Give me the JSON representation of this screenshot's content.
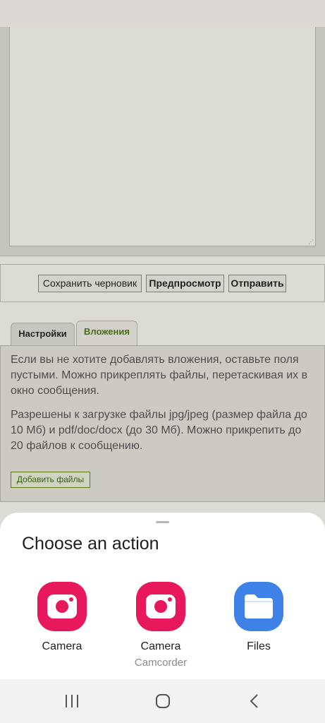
{
  "page": {
    "buttons": {
      "save_draft": "Сохранить черновик",
      "preview": "Предпросмотр",
      "send": "Отправить"
    },
    "tabs": [
      {
        "label": "Настройки",
        "active": false
      },
      {
        "label": "Вложения",
        "active": true
      }
    ],
    "attachments": {
      "paragraph1": "Если вы не хотите добавлять вложения, оставьте поля пустыми. Можно прикреплять файлы, перетаскивая их в окно сообщения.",
      "paragraph2": "Разрешены к загрузке файлы jpg/jpeg (размер файла до 10 Мб) и pdf/doc/docx (до 30 Мб). Можно прикрепить до 20 файлов к сообщению.",
      "add_files_button": "Добавить файлы"
    }
  },
  "sheet": {
    "title": "Choose an action",
    "apps": [
      {
        "label": "Camera",
        "sublabel": "",
        "icon": "camera-app-icon"
      },
      {
        "label": "Camera",
        "sublabel": "Camcorder",
        "icon": "camera-app-icon"
      },
      {
        "label": "Files",
        "sublabel": "",
        "icon": "folder-app-icon"
      }
    ]
  },
  "navbar": {
    "buttons": [
      "recent-apps-icon",
      "home-icon",
      "back-icon"
    ]
  },
  "colors": {
    "camera_icon_bg": "#e8185d",
    "files_icon_bg": "#3e82e8",
    "tab_active_text": "#4b6c16",
    "scrim_page_bg": "#dcdcd7"
  }
}
